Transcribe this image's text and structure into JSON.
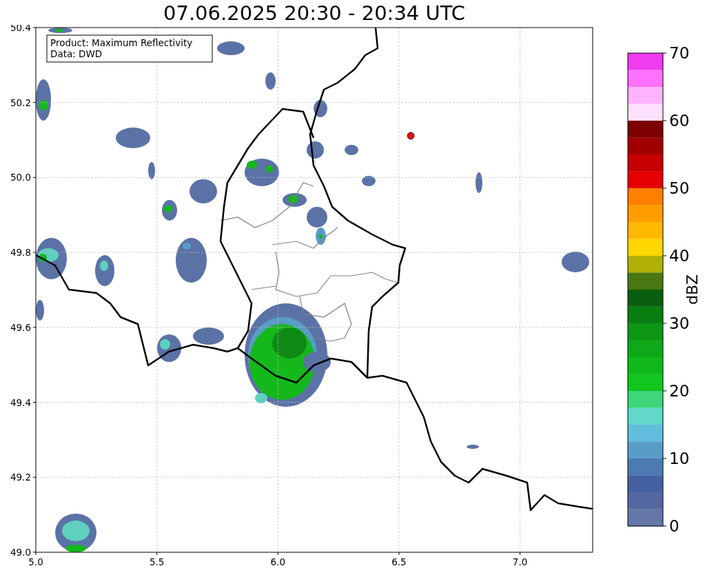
{
  "title": "07.06.2025 20:30 - 20:34 UTC",
  "info_box": {
    "lines": [
      "Product: Maximum Reflectivity",
      "Data: DWD"
    ]
  },
  "map": {
    "x_ticks": [
      "5.0",
      "5.5",
      "6.0",
      "6.5",
      "7.0"
    ],
    "y_ticks": [
      "50.4",
      "50.2",
      "50.0",
      "49.8",
      "49.6",
      "49.4",
      "49.2",
      "49.0"
    ]
  },
  "colorbar": {
    "label": "dBZ",
    "ticks": [
      "70",
      "60",
      "50",
      "40",
      "30",
      "20",
      "10",
      "0"
    ],
    "bins": [
      {
        "color": "#ee3cee"
      },
      {
        "color": "#ff72ff"
      },
      {
        "color": "#ffb3ff"
      },
      {
        "color": "#ffe0ff"
      },
      {
        "color": "#7c0000"
      },
      {
        "color": "#a20000"
      },
      {
        "color": "#c60000"
      },
      {
        "color": "#e40000"
      },
      {
        "color": "#ff7f00"
      },
      {
        "color": "#ff9d00"
      },
      {
        "color": "#ffb800"
      },
      {
        "color": "#ffd700"
      },
      {
        "color": "#b0b008"
      },
      {
        "color": "#4a7812"
      },
      {
        "color": "#0a5e10"
      },
      {
        "color": "#0a7e12"
      },
      {
        "color": "#0c9614"
      },
      {
        "color": "#0ea818"
      },
      {
        "color": "#10b81c"
      },
      {
        "color": "#11c61f"
      },
      {
        "color": "#3fd57a"
      },
      {
        "color": "#62d8c8"
      },
      {
        "color": "#62bddf"
      },
      {
        "color": "#5a9cc8"
      },
      {
        "color": "#4c7bb3"
      },
      {
        "color": "#4560a3"
      },
      {
        "color": "#5567a3"
      },
      {
        "color": "#6577a8"
      }
    ]
  }
}
